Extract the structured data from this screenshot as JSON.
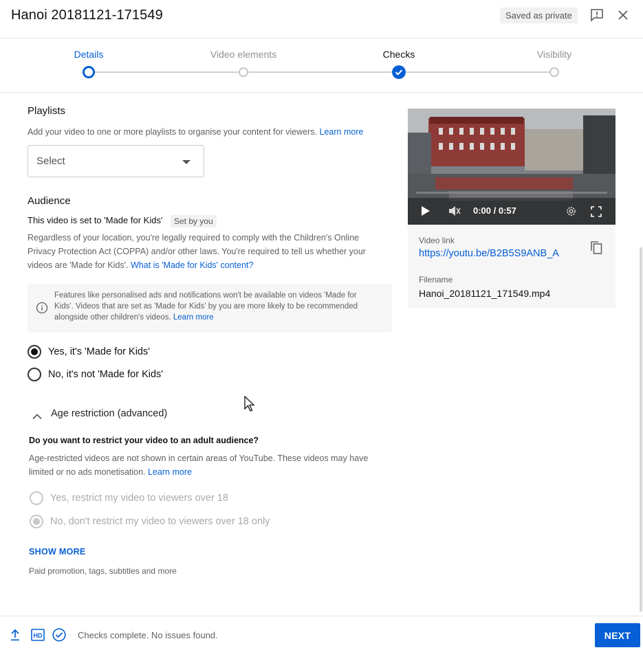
{
  "header": {
    "title": "Hanoi 20181121-171549",
    "saved_badge": "Saved as private",
    "feedback_icon": "feedback-icon",
    "close_icon": "close-icon"
  },
  "stepper": {
    "steps": [
      {
        "label": "Details",
        "state": "current"
      },
      {
        "label": "Video elements",
        "state": "upcoming"
      },
      {
        "label": "Checks",
        "state": "done"
      },
      {
        "label": "Visibility",
        "state": "upcoming"
      }
    ]
  },
  "playlists": {
    "title": "Playlists",
    "description": "Add your video to one or more playlists to organise your content for viewers.",
    "learn_more": "Learn more",
    "select_value": "Select"
  },
  "audience": {
    "title": "Audience",
    "status": "This video is set to 'Made for Kids'",
    "set_by": "Set by you",
    "desc_line1": "Regardless of your location, you're legally required to comply with the Children's Online",
    "desc_line2": "Privacy Protection Act (COPPA) and/or other laws. You're required to tell us whether your",
    "desc_line3": "videos are 'Made for Kids'.",
    "what_is_link": "What is 'Made for Kids' content?",
    "info_line1": "Features like personalised ads and notifications won't be available on videos 'Made for",
    "info_line2": "Kids'. Videos that are set as 'Made for Kids' by you are more likely to be recommended",
    "info_line3": "alongside other children's videos.",
    "info_learn_more": "Learn more",
    "options": [
      {
        "label": "Yes, it's 'Made for Kids'",
        "checked": true
      },
      {
        "label": "No, it's not 'Made for Kids'",
        "checked": false
      }
    ]
  },
  "age_restriction": {
    "title": "Age restriction (advanced)",
    "question": "Do you want to restrict your video to an adult audience?",
    "desc_line1": "Age-restricted videos are not shown in certain areas of YouTube. These videos may have",
    "desc_line2": "limited or no ads monetisation.",
    "learn_more": "Learn more",
    "options": [
      {
        "label": "Yes, restrict my video to viewers over 18",
        "checked": false
      },
      {
        "label": "No, don't restrict my video to viewers over 18 only",
        "checked": true
      }
    ]
  },
  "more": {
    "show_more": "SHOW MORE",
    "paid_text": "Paid promotion, tags, subtitles and more"
  },
  "video": {
    "time": "0:00 / 0:57",
    "link_label": "Video link",
    "link": "https://youtu.be/B2B5S9ANB_A",
    "filename_label": "Filename",
    "filename": "Hanoi_20181121_171549.mp4"
  },
  "footer": {
    "status": "Checks complete. No issues found.",
    "next": "NEXT",
    "hd_label": "HD"
  },
  "colors": {
    "accent": "#065fd4",
    "text": "#0d0d0d",
    "muted": "#606060"
  }
}
